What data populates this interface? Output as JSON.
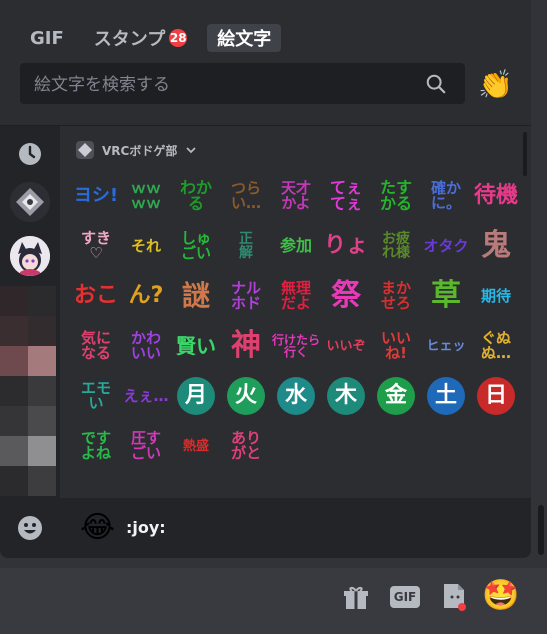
{
  "tabs": [
    {
      "label": "GIF",
      "badge": ""
    },
    {
      "label": "スタンプ",
      "badge": "28"
    },
    {
      "label": "絵文字",
      "badge": ""
    }
  ],
  "search": {
    "placeholder": "絵文字を検索する"
  },
  "header_emoji": "👏",
  "category": {
    "name": "VRCボドゲ部"
  },
  "emojis": [
    {
      "text": "ヨシ!",
      "color": "#2a6bdc",
      "size": 18
    },
    {
      "text": "ｗｗ\nｗｗ",
      "color": "#2fa84f",
      "size": 15
    },
    {
      "text": "わか\nる",
      "color": "#1f9a2b",
      "size": 16
    },
    {
      "text": "つら\nい…",
      "color": "#8a5a2b",
      "size": 15
    },
    {
      "text": "天才\nかよ",
      "color": "#c03ab8",
      "size": 15
    },
    {
      "text": "てぇ\nてぇ",
      "color": "#e03ad8",
      "size": 16
    },
    {
      "text": "たす\nかる",
      "color": "#26b52a",
      "size": 16
    },
    {
      "text": "確か\nに。",
      "color": "#4a6ed8",
      "size": 15
    },
    {
      "text": "待機",
      "color": "#e83a8a",
      "size": 22
    },
    {
      "text": "すき\n♡",
      "color": "#f2a7c8",
      "size": 15
    },
    {
      "text": "それ",
      "color": "#e0c020",
      "size": 15
    },
    {
      "text": "しゅ\nごい",
      "color": "#28b838",
      "size": 15
    },
    {
      "text": "正\n解",
      "color": "#2e8b6e",
      "size": 14
    },
    {
      "text": "参加",
      "color": "#3fbf48",
      "size": 16
    },
    {
      "text": "りょ",
      "color": "#e0408a",
      "size": 22
    },
    {
      "text": "お疲\nれ様",
      "color": "#5a8a2a",
      "size": 14
    },
    {
      "text": "オタク",
      "color": "#6a3ad8",
      "size": 15
    },
    {
      "text": "鬼",
      "color": "#b87a7a",
      "size": 30
    },
    {
      "text": "おこ",
      "color": "#e83030",
      "size": 22
    },
    {
      "text": "ん?",
      "color": "#e0a020",
      "size": 22
    },
    {
      "text": "謎",
      "color": "#d0784a",
      "size": 28
    },
    {
      "text": "ナル\nホド",
      "color": "#b040d8",
      "size": 15
    },
    {
      "text": "無理\nだよ",
      "color": "#e02040",
      "size": 15
    },
    {
      "text": "祭",
      "color": "#e83ab8",
      "size": 30
    },
    {
      "text": "まか\nせろ",
      "color": "#d83030",
      "size": 15
    },
    {
      "text": "草",
      "color": "#5ab82a",
      "size": 30
    },
    {
      "text": "期待",
      "color": "#28b8e8",
      "size": 15
    },
    {
      "text": "気に\nなる",
      "color": "#e04070",
      "size": 15
    },
    {
      "text": "かわ\nいい",
      "color": "#a040e0",
      "size": 15
    },
    {
      "text": "賢い",
      "color": "#3ad868",
      "size": 20
    },
    {
      "text": "神",
      "color": "#e04070",
      "size": 30
    },
    {
      "text": "行けたら\n行く",
      "color": "#e03ab8",
      "size": 12
    },
    {
      "text": "いいぞ",
      "color": "#e83a5a",
      "size": 13
    },
    {
      "text": "いい\nね!",
      "color": "#e03a3a",
      "size": 15
    },
    {
      "text": "ヒェッ",
      "color": "#6a8ad8",
      "size": 13
    },
    {
      "text": "ぐぬ\nぬ…",
      "color": "#e0b030",
      "size": 15
    },
    {
      "text": "エモ\nい",
      "color": "#28a898",
      "size": 15
    },
    {
      "text": "えぇ…",
      "color": "#8a3ad8",
      "size": 15
    },
    {
      "circle": true,
      "text": "月",
      "bg": "#1e8a7a"
    },
    {
      "circle": true,
      "text": "火",
      "bg": "#1e9e5a"
    },
    {
      "circle": true,
      "text": "水",
      "bg": "#1e8a8a"
    },
    {
      "circle": true,
      "text": "木",
      "bg": "#1e8a7a"
    },
    {
      "circle": true,
      "text": "金",
      "bg": "#1e9e4a"
    },
    {
      "circle": true,
      "text": "土",
      "bg": "#1e6ab8"
    },
    {
      "circle": true,
      "text": "日",
      "bg": "#c82a2a"
    },
    {
      "text": "です\nよね",
      "color": "#2ab84a",
      "size": 15
    },
    {
      "text": "圧す\nごい",
      "color": "#d03ab8",
      "size": 15
    },
    {
      "text": "熱盛",
      "color": "#e02a2a",
      "size": 13
    },
    {
      "text": "あり\nがと",
      "color": "#e0407a",
      "size": 15
    }
  ],
  "preview": {
    "emoji": "😂",
    "name": ":joy:"
  },
  "bottom_emoji": "🤩",
  "bottom_gif": "GIF"
}
